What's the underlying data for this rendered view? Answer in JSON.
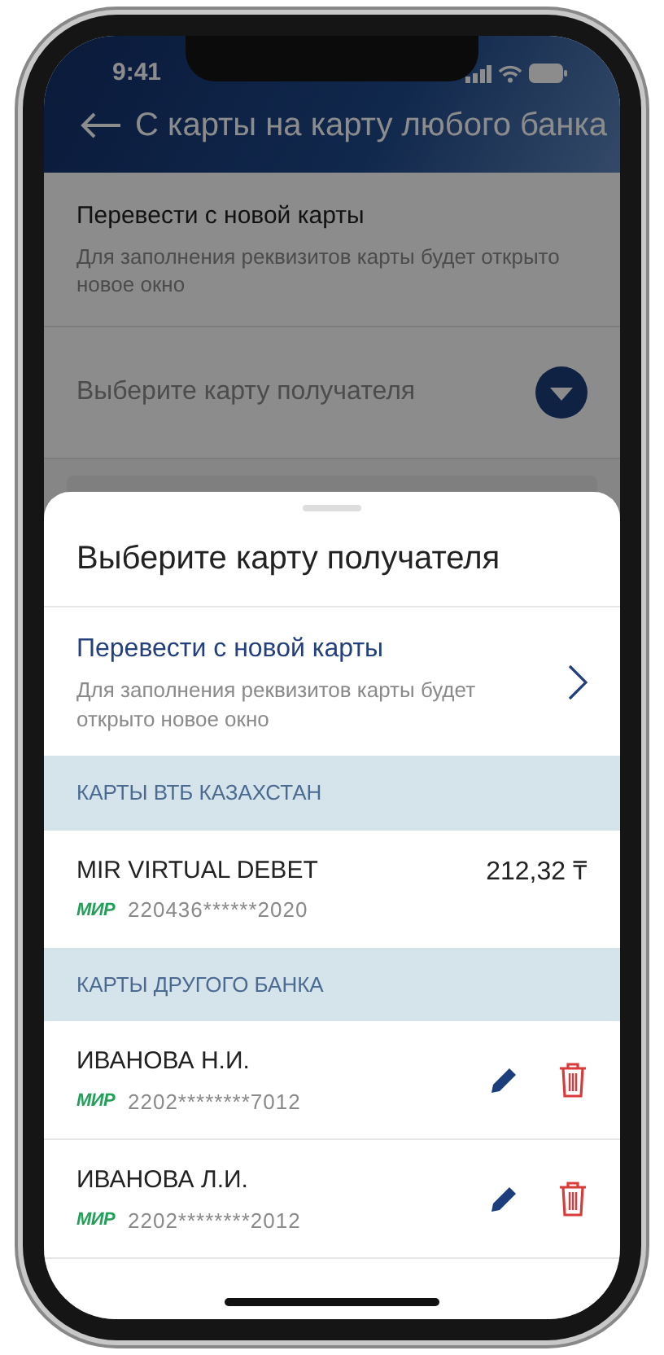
{
  "status_bar": {
    "time": "9:41"
  },
  "header": {
    "title": "С карты на карту любого банка"
  },
  "background_form": {
    "new_card": {
      "title": "Перевести с новой карты",
      "subtitle": "Для заполнения реквизитов карты будет открыто новое окно"
    },
    "recipient_select": {
      "label": "Выберите карту получателя"
    }
  },
  "sheet": {
    "title": "Выберите карту получателя",
    "new_card": {
      "title": "Перевести с новой карты",
      "subtitle": "Для заполнения реквизитов карты будет открыто новое окно"
    },
    "sections": [
      {
        "title": "КАРТЫ ВТБ КАЗАХСТАН",
        "cards": [
          {
            "kind": "own",
            "name": "MIR VIRTUAL DEBET",
            "payment_system": "МИР",
            "number": "220436******2020",
            "balance": "212,32 ₸"
          }
        ]
      },
      {
        "title": "КАРТЫ ДРУГОГО БАНКА",
        "cards": [
          {
            "kind": "saved",
            "name": "ИВАНОВА Н.И.",
            "payment_system": "МИР",
            "number": "2202********7012"
          },
          {
            "kind": "saved",
            "name": "ИВАНОВА Л.И.",
            "payment_system": "МИР",
            "number": "2202********2012"
          }
        ]
      }
    ]
  }
}
